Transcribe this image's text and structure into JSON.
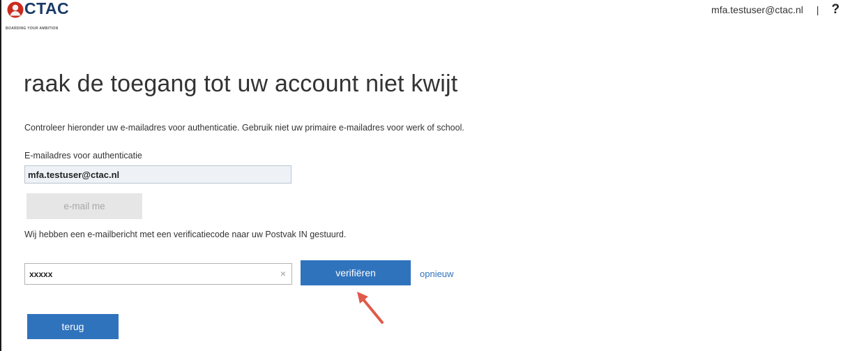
{
  "header": {
    "logo_text": "CTAC",
    "logo_tagline": "BOARDING YOUR AMBITION",
    "user_email": "mfa.testuser@ctac.nl",
    "separator": "|",
    "help_label": "?"
  },
  "main": {
    "title": "raak de toegang tot uw account niet kwijt",
    "instruction": "Controleer hieronder uw e-mailadres voor authenticatie. Gebruik niet uw primaire e-mailadres voor werk of school.",
    "email_label": "E-mailadres voor authenticatie",
    "email_value": "mfa.testuser@ctac.nl",
    "email_me_label": "e-mail me",
    "sent_message": "Wij hebben een e-mailbericht met een verificatiecode naar uw Postvak IN gestuurd.",
    "code_value": "xxxxx",
    "clear_glyph": "×",
    "verify_label": "verifiëren",
    "resend_label": "opnieuw",
    "back_label": "terug"
  },
  "icons": {
    "logo": "ctac-logo-icon",
    "help": "help-icon",
    "clear": "clear-icon",
    "annotation": "red-arrow-icon"
  },
  "colors": {
    "primary": "#2f73bd",
    "disabled_bg": "#e6e6e6",
    "disabled_text": "#a8a8a8",
    "brand_red": "#cc2a1f",
    "brand_navy": "#1a3a66",
    "annotation": "#e05a4a"
  }
}
